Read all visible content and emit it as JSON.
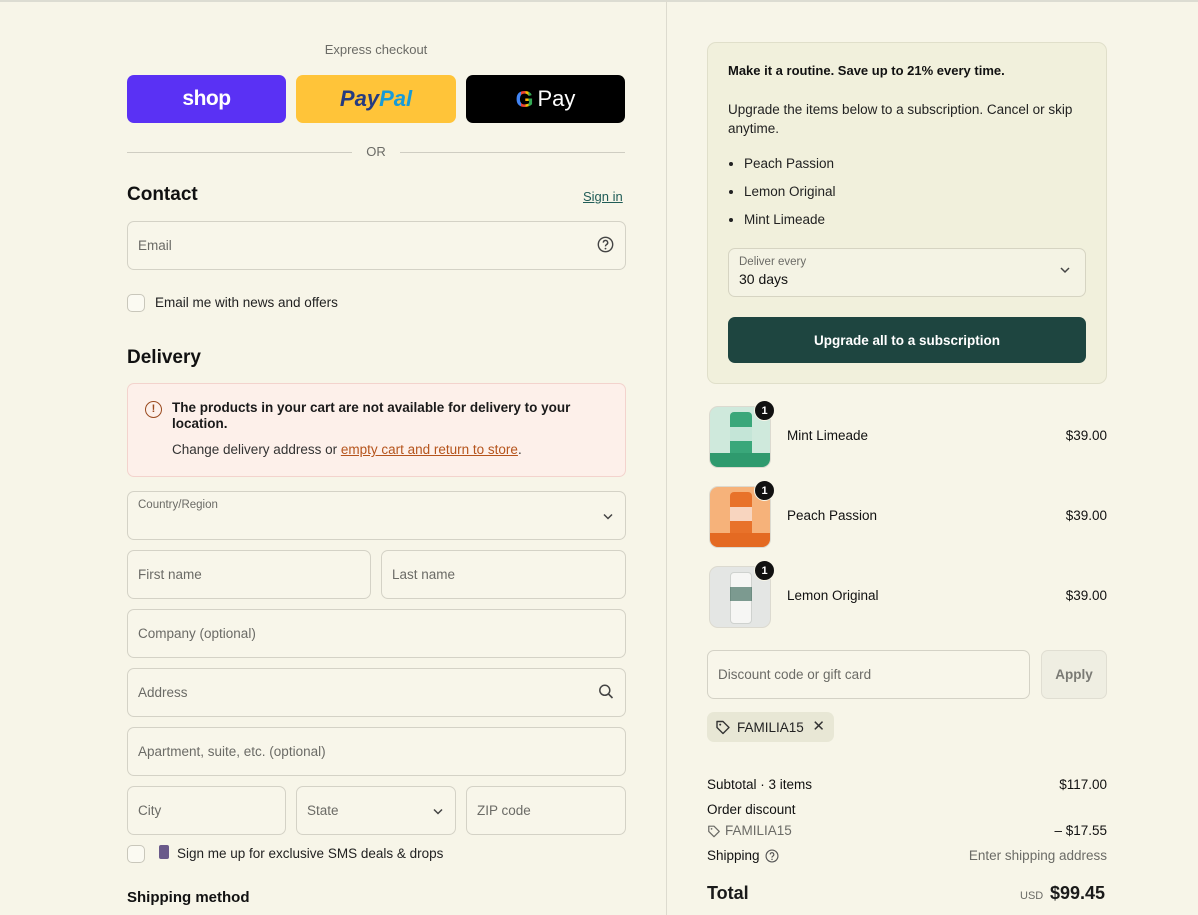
{
  "express": {
    "label": "Express checkout",
    "shop_label": "shop",
    "paypal_part1": "Pay",
    "paypal_part2": "Pal",
    "gpay_g": "G",
    "gpay_label": "Pay",
    "or_label": "OR"
  },
  "contact": {
    "title": "Contact",
    "signin_label": "Sign in",
    "email_placeholder": "Email",
    "newsletter_label": "Email me with news and offers"
  },
  "delivery": {
    "title": "Delivery",
    "warning_title": "The products in your cart are not available for delivery to your location.",
    "warning_text_prefix": "Change delivery address or ",
    "warning_link": "empty cart and return to store",
    "warning_text_suffix": ".",
    "country_label": "Country/Region",
    "first_name": "First name",
    "last_name": "Last name",
    "company": "Company (optional)",
    "address": "Address",
    "apartment": "Apartment, suite, etc. (optional)",
    "city": "City",
    "state": "State",
    "zip": "ZIP code",
    "sms_label": "Sign me up for exclusive SMS deals & drops"
  },
  "shipping_method": {
    "title": "Shipping method"
  },
  "subscription": {
    "title": "Make it a routine. Save up to 21% every time.",
    "description": "Upgrade the items below to a subscription. Cancel or skip anytime.",
    "items": [
      "Peach Passion",
      "Lemon Original",
      "Mint Limeade"
    ],
    "deliver_label": "Deliver every",
    "deliver_value": "30 days",
    "upgrade_button": "Upgrade all to a subscription"
  },
  "cart": {
    "items": [
      {
        "name": "Mint Limeade",
        "qty": "1",
        "price": "$39.00",
        "color": "#3aa77a",
        "bg": "#cfe9dc"
      },
      {
        "name": "Peach Passion",
        "qty": "1",
        "price": "$39.00",
        "color": "#e8722a",
        "bg": "#f6b27a"
      },
      {
        "name": "Lemon Original",
        "qty": "1",
        "price": "$39.00",
        "color": "#f2f2f0",
        "bg": "#e4e6e4"
      }
    ]
  },
  "discount": {
    "placeholder": "Discount code or gift card",
    "apply_label": "Apply",
    "code": "FAMILIA15"
  },
  "summary": {
    "subtotal_label": "Subtotal · 3 items",
    "subtotal_value": "$117.00",
    "order_discount_label": "Order discount",
    "discount_code": "FAMILIA15",
    "discount_value": "– $17.55",
    "shipping_label": "Shipping",
    "shipping_value": "Enter shipping address",
    "total_label": "Total",
    "total_currency": "USD",
    "total_value": "$99.45"
  }
}
